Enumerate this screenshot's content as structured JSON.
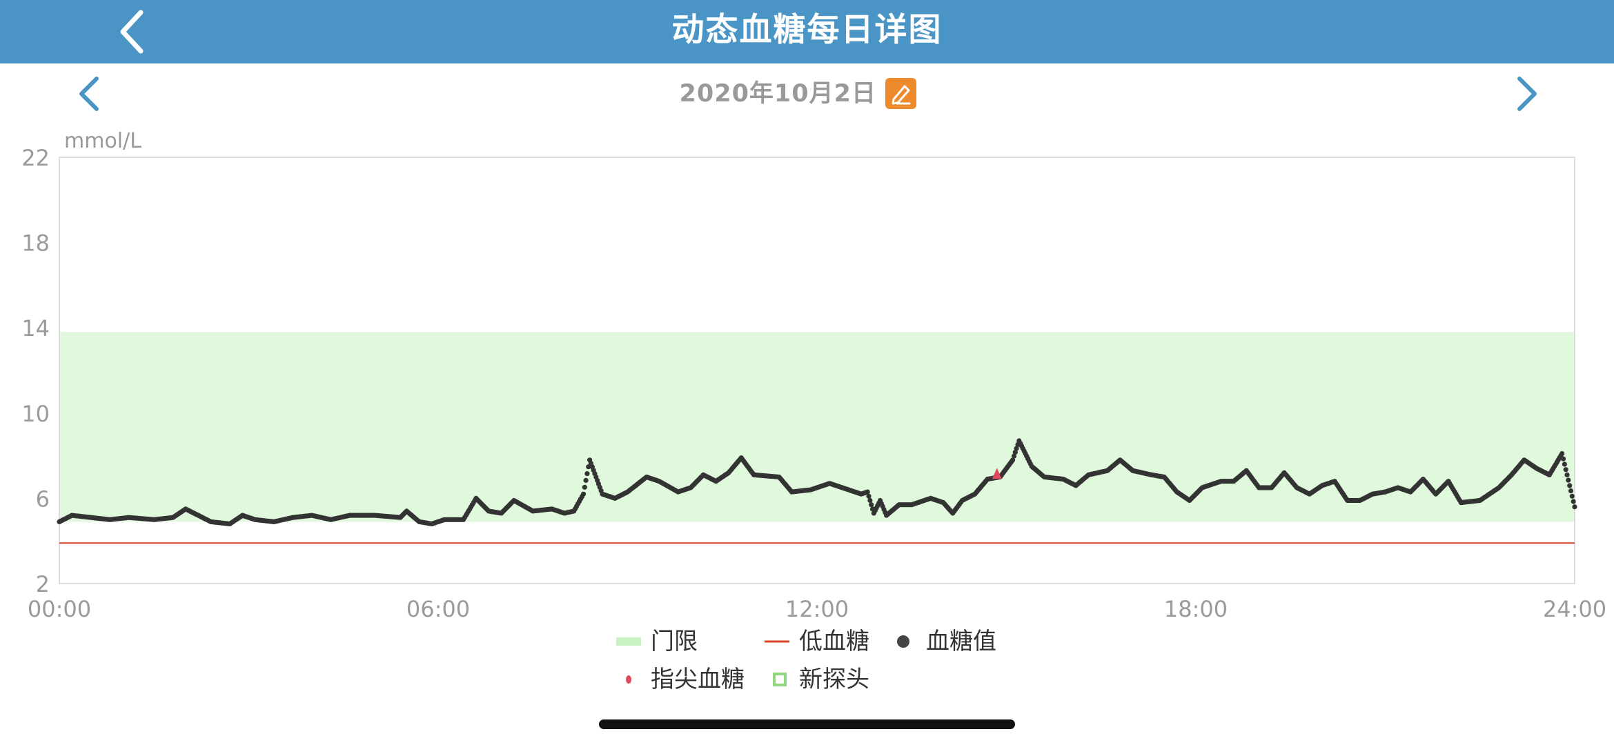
{
  "header": {
    "title": "动态血糖每日详图",
    "back_icon": "chevron-left-icon",
    "background": "#4a95c6"
  },
  "date_nav": {
    "date": "2020年10月2日",
    "prev_icon": "chevron-left-icon",
    "next_icon": "chevron-right-icon",
    "edit_icon": "pencil-edit-icon",
    "edit_color": "#ef8a2c"
  },
  "chart_data": {
    "type": "scatter",
    "ylabel": "mmol/L",
    "y_ticks": [
      "22",
      "18",
      "14",
      "10",
      "6",
      "2"
    ],
    "x_ticks": [
      "00:00",
      "06:00",
      "12:00",
      "18:00",
      "24:00"
    ],
    "ylim": [
      2,
      22
    ],
    "xlim_hours": [
      0,
      24
    ],
    "threshold_band": {
      "low": 4.9,
      "high": 13.8,
      "color": "#e0f8dc"
    },
    "hypo_line": {
      "value": 3.9,
      "color": "#d9452b"
    },
    "glucose_series": {
      "color": "#333333",
      "points": [
        [
          0.0,
          4.9
        ],
        [
          0.2,
          5.2
        ],
        [
          0.5,
          5.1
        ],
        [
          0.8,
          5.0
        ],
        [
          1.1,
          5.1
        ],
        [
          1.5,
          5.0
        ],
        [
          1.8,
          5.1
        ],
        [
          2.0,
          5.5
        ],
        [
          2.2,
          5.2
        ],
        [
          2.4,
          4.9
        ],
        [
          2.7,
          4.8
        ],
        [
          2.9,
          5.2
        ],
        [
          3.1,
          5.0
        ],
        [
          3.4,
          4.9
        ],
        [
          3.7,
          5.1
        ],
        [
          4.0,
          5.2
        ],
        [
          4.3,
          5.0
        ],
        [
          4.6,
          5.2
        ],
        [
          5.0,
          5.2
        ],
        [
          5.4,
          5.1
        ],
        [
          5.5,
          5.4
        ],
        [
          5.7,
          4.9
        ],
        [
          5.9,
          4.8
        ],
        [
          6.1,
          5.0
        ],
        [
          6.4,
          5.0
        ],
        [
          6.6,
          6.0
        ],
        [
          6.8,
          5.4
        ],
        [
          7.0,
          5.3
        ],
        [
          7.2,
          5.9
        ],
        [
          7.5,
          5.4
        ],
        [
          7.8,
          5.5
        ],
        [
          8.0,
          5.3
        ],
        [
          8.15,
          5.4
        ],
        [
          8.3,
          6.2
        ],
        [
          8.4,
          7.8
        ],
        [
          8.6,
          6.2
        ],
        [
          8.8,
          6.0
        ],
        [
          9.0,
          6.3
        ],
        [
          9.3,
          7.0
        ],
        [
          9.5,
          6.8
        ],
        [
          9.8,
          6.3
        ],
        [
          10.0,
          6.5
        ],
        [
          10.2,
          7.1
        ],
        [
          10.4,
          6.8
        ],
        [
          10.6,
          7.2
        ],
        [
          10.8,
          7.9
        ],
        [
          11.0,
          7.1
        ],
        [
          11.4,
          7.0
        ],
        [
          11.6,
          6.3
        ],
        [
          11.9,
          6.4
        ],
        [
          12.2,
          6.7
        ],
        [
          12.5,
          6.4
        ],
        [
          12.7,
          6.2
        ],
        [
          12.8,
          6.3
        ],
        [
          12.9,
          5.3
        ],
        [
          13.0,
          5.9
        ],
        [
          13.1,
          5.2
        ],
        [
          13.3,
          5.7
        ],
        [
          13.5,
          5.7
        ],
        [
          13.8,
          6.0
        ],
        [
          14.0,
          5.8
        ],
        [
          14.15,
          5.3
        ],
        [
          14.3,
          5.9
        ],
        [
          14.5,
          6.2
        ],
        [
          14.7,
          6.9
        ],
        [
          14.9,
          7.0
        ],
        [
          15.1,
          7.8
        ],
        [
          15.2,
          8.7
        ],
        [
          15.4,
          7.5
        ],
        [
          15.6,
          7.0
        ],
        [
          15.9,
          6.9
        ],
        [
          16.1,
          6.6
        ],
        [
          16.3,
          7.1
        ],
        [
          16.6,
          7.3
        ],
        [
          16.8,
          7.8
        ],
        [
          17.0,
          7.3
        ],
        [
          17.3,
          7.1
        ],
        [
          17.5,
          7.0
        ],
        [
          17.7,
          6.3
        ],
        [
          17.9,
          5.9
        ],
        [
          18.1,
          6.5
        ],
        [
          18.4,
          6.8
        ],
        [
          18.6,
          6.8
        ],
        [
          18.8,
          7.3
        ],
        [
          19.0,
          6.5
        ],
        [
          19.2,
          6.5
        ],
        [
          19.4,
          7.2
        ],
        [
          19.6,
          6.5
        ],
        [
          19.8,
          6.2
        ],
        [
          20.0,
          6.6
        ],
        [
          20.2,
          6.8
        ],
        [
          20.4,
          5.9
        ],
        [
          20.6,
          5.9
        ],
        [
          20.8,
          6.2
        ],
        [
          21.0,
          6.3
        ],
        [
          21.2,
          6.5
        ],
        [
          21.4,
          6.3
        ],
        [
          21.6,
          6.9
        ],
        [
          21.8,
          6.2
        ],
        [
          22.0,
          6.8
        ],
        [
          22.2,
          5.8
        ],
        [
          22.5,
          5.9
        ],
        [
          22.8,
          6.5
        ],
        [
          23.0,
          7.1
        ],
        [
          23.2,
          7.8
        ],
        [
          23.4,
          7.4
        ],
        [
          23.6,
          7.1
        ],
        [
          23.8,
          8.1
        ],
        [
          24.0,
          5.6
        ]
      ]
    },
    "fingertip_points": {
      "color": "#e0485e",
      "points": [
        [
          14.85,
          7.1
        ]
      ]
    },
    "legend": [
      {
        "label": "门限",
        "symbol": "band"
      },
      {
        "label": "低血糖",
        "symbol": "line"
      },
      {
        "label": "血糖值",
        "symbol": "dot"
      },
      {
        "label": "指尖血糖",
        "symbol": "pink-dot"
      },
      {
        "label": "新探头",
        "symbol": "square"
      }
    ]
  }
}
